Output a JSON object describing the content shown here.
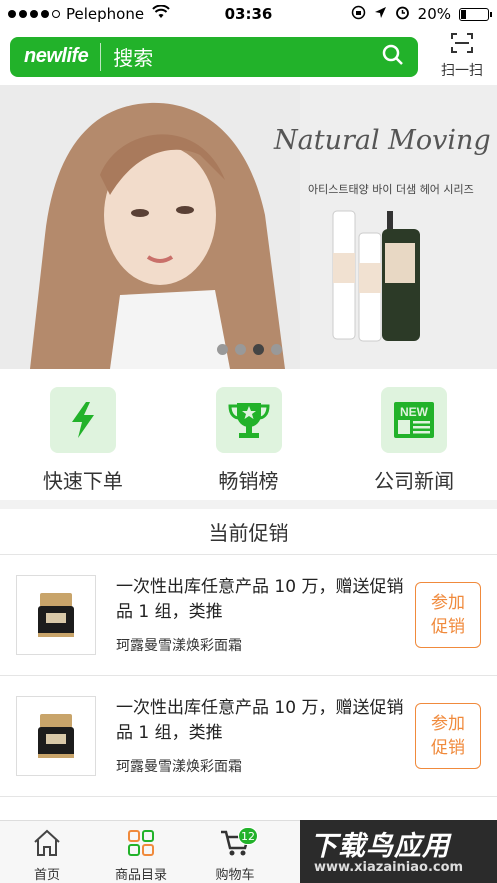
{
  "status_bar": {
    "carrier": "Pelephone",
    "time": "03:36",
    "battery_percent": "20%",
    "battery_level": 0.2,
    "signal_bars_filled": 4,
    "signal_bars_total": 5
  },
  "header": {
    "logo": "newlife",
    "search_placeholder": "搜索",
    "scan_label": "扫一扫"
  },
  "banner": {
    "title": "Natural Moving Hair",
    "subtitle": "아티스트태양 바이 더샘 헤어 시리즈",
    "dot_count": 4,
    "active_dot": 2
  },
  "quick_menu": [
    {
      "label": "快速下单",
      "icon": "lightning-icon"
    },
    {
      "label": "畅销榜",
      "icon": "trophy-icon"
    },
    {
      "label": "公司新闻",
      "icon": "news-icon"
    }
  ],
  "promo": {
    "title": "当前促销",
    "items": [
      {
        "description": "一次性出库任意产品 10 万，赠送促销品 1 组，类推",
        "product": "珂露曼雪漾焕彩面霜",
        "button": "参加促销"
      },
      {
        "description": "一次性出库任意产品 10 万，赠送促销品 1 组，类推",
        "product": "珂露曼雪漾焕彩面霜",
        "button": "参加促销"
      }
    ]
  },
  "tab_bar": {
    "tabs": [
      {
        "label": "首页",
        "icon": "home-icon"
      },
      {
        "label": "商品目录",
        "icon": "grid-icon"
      },
      {
        "label": "购物车",
        "icon": "cart-icon",
        "badge": "12"
      }
    ]
  },
  "watermark": {
    "main": "下载鸟应用",
    "url": "www.xiazainiao.com"
  },
  "colors": {
    "brand_green": "#22b22a",
    "accent_orange": "#f08a3c",
    "icon_bg": "#dff3de"
  }
}
